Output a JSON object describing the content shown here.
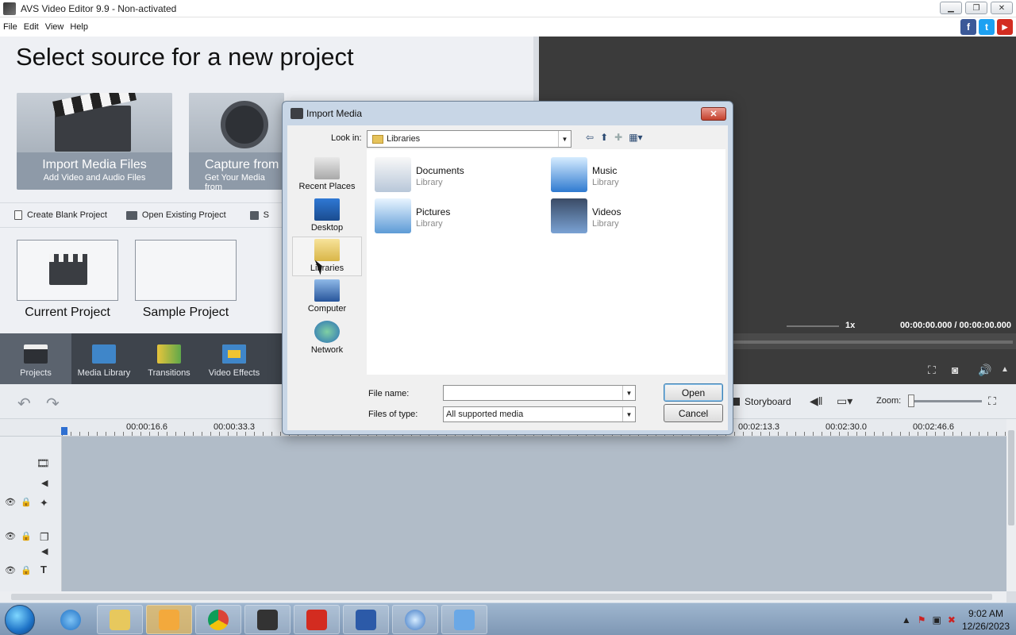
{
  "window": {
    "title": "AVS Video Editor 9.9 - Non-activated",
    "minimize_glyph": "▁",
    "restore_glyph": "❐",
    "close_glyph": "✕"
  },
  "menu": [
    "File",
    "Edit",
    "View",
    "Help"
  ],
  "social": {
    "facebook": "f",
    "twitter": "t",
    "youtube": "▶"
  },
  "start": {
    "heading": "Select source for a new project",
    "import_title": "Import Media Files",
    "import_sub": "Add Video and Audio Files",
    "capture_title": "Capture from",
    "capture_sub": "Get Your Media from",
    "links": {
      "blank": "Create Blank Project",
      "existing": "Open Existing Project",
      "third": "S"
    },
    "current_project": "Current Project",
    "sample_project": "Sample Project"
  },
  "preview": {
    "speed": "1x",
    "time": "00:00:00.000 / 00:00:00.000"
  },
  "tabs": [
    "Projects",
    "Media Library",
    "Transitions",
    "Video Effects"
  ],
  "timeline": {
    "storyboard": "Storyboard",
    "zoom_label": "Zoom:",
    "ruler": [
      "00:00:16.6",
      "00:00:33.3",
      "00:02:13.3",
      "00:02:30.0",
      "00:02:46.6"
    ]
  },
  "dialog": {
    "title": "Import Media",
    "look_in_label": "Look in:",
    "look_in_value": "Libraries",
    "places": [
      "Recent Places",
      "Desktop",
      "Libraries",
      "Computer",
      "Network"
    ],
    "items": [
      {
        "name": "Documents",
        "type": "Library"
      },
      {
        "name": "Music",
        "type": "Library"
      },
      {
        "name": "Pictures",
        "type": "Library"
      },
      {
        "name": "Videos",
        "type": "Library"
      }
    ],
    "file_name_label": "File name:",
    "file_name_value": "",
    "files_of_type_label": "Files of type:",
    "files_of_type_value": "All supported media",
    "open_label": "Open",
    "cancel_label": "Cancel"
  },
  "taskbar": {
    "time": "9:02 AM",
    "date": "12/26/2023"
  }
}
